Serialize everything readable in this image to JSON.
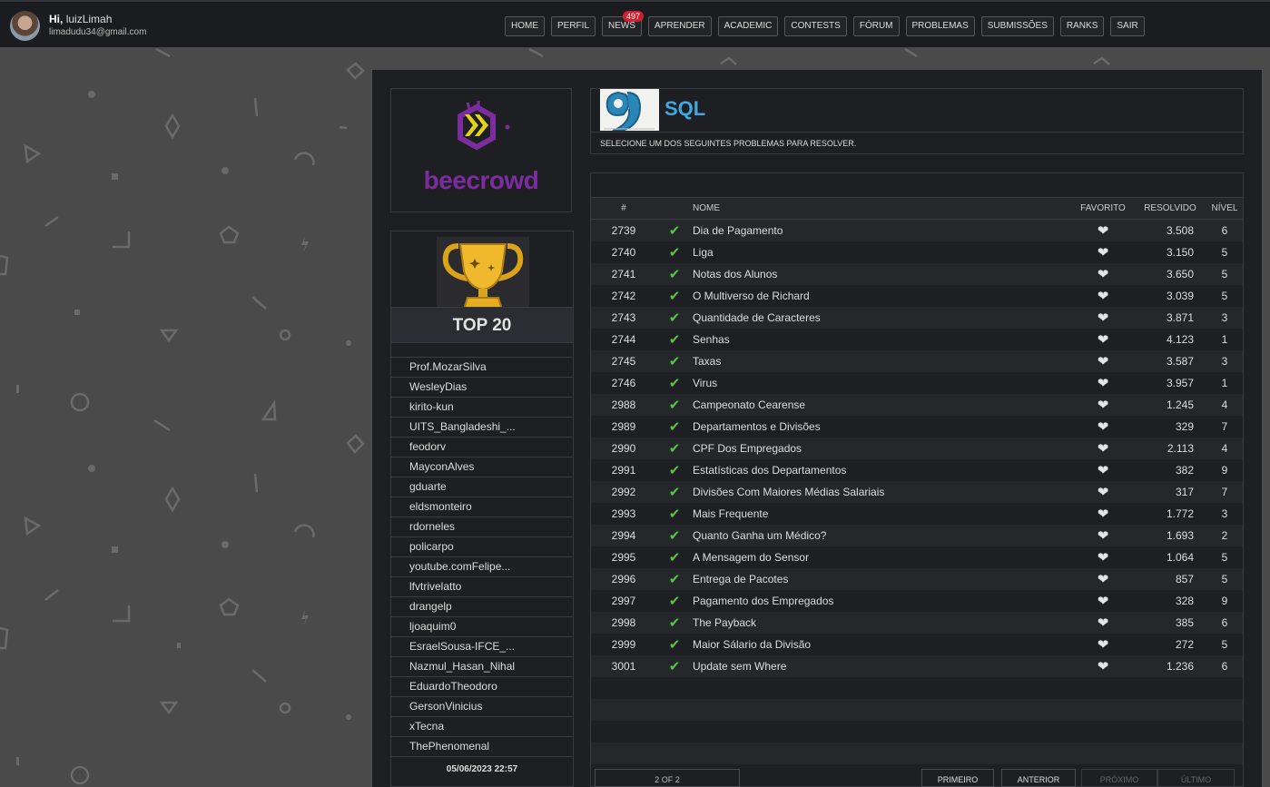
{
  "user": {
    "greeting": "Hi,",
    "name": "luizLimah",
    "email": "limadudu34@gmail.com"
  },
  "nav": [
    {
      "label": "HOME"
    },
    {
      "label": "PERFIL"
    },
    {
      "label": "NEWS",
      "badge": "497"
    },
    {
      "label": "APRENDER"
    },
    {
      "label": "ACADEMIC"
    },
    {
      "label": "CONTESTS"
    },
    {
      "label": "FÓRUM"
    },
    {
      "label": "PROBLEMAS"
    },
    {
      "label": "SUBMISSÕES"
    },
    {
      "label": "RANKS"
    },
    {
      "label": "SAIR"
    }
  ],
  "logo": {
    "text": "beecrowd",
    "color": "#7b2c9e",
    "accent": "#e7d21a"
  },
  "top20": {
    "title": "TOP 20",
    "users": [
      "Prof.MozarSilva",
      "WesleyDias",
      "kirito-kun",
      "UITS_Bangladeshi_...",
      "feodorv",
      "MayconAlves",
      "gduarte",
      "eldsmonteiro",
      "rdorneles",
      "policarpo",
      "youtube.comFelipe...",
      "lfvtrivelatto",
      "drangelp",
      "ljoaquim0",
      "EsraelSousa-IFCE_...",
      "Nazmul_Hasan_Nihal",
      "EduardoTheodoro",
      "GersonVinicius",
      "xTecna",
      "ThePhenomenal"
    ],
    "date": "05/06/2023 22:57"
  },
  "category": {
    "title": "SQL",
    "subtitle": "SELECIONE UM DOS SEGUINTES PROBLEMAS PARA RESOLVER.",
    "title_color": "#3fa8e0"
  },
  "table": {
    "headers": {
      "id": "#",
      "name": "NOME",
      "fav": "FAVORITO",
      "solved": "RESOLVIDO",
      "level": "NÍVEL"
    },
    "rows": [
      {
        "id": "2739",
        "name": "Dia de Pagamento",
        "solved": "3.508",
        "level": "6"
      },
      {
        "id": "2740",
        "name": "Liga",
        "solved": "3.150",
        "level": "5"
      },
      {
        "id": "2741",
        "name": "Notas dos Alunos",
        "solved": "3.650",
        "level": "5"
      },
      {
        "id": "2742",
        "name": "O Multiverso de Richard",
        "solved": "3.039",
        "level": "5"
      },
      {
        "id": "2743",
        "name": "Quantidade de Caracteres",
        "solved": "3.871",
        "level": "3"
      },
      {
        "id": "2744",
        "name": "Senhas",
        "solved": "4.123",
        "level": "1"
      },
      {
        "id": "2745",
        "name": "Taxas",
        "solved": "3.587",
        "level": "3"
      },
      {
        "id": "2746",
        "name": "Virus",
        "solved": "3.957",
        "level": "1"
      },
      {
        "id": "2988",
        "name": "Campeonato Cearense",
        "solved": "1.245",
        "level": "4"
      },
      {
        "id": "2989",
        "name": "Departamentos e Divisões",
        "solved": "329",
        "level": "7"
      },
      {
        "id": "2990",
        "name": "CPF Dos Empregados",
        "solved": "2.113",
        "level": "4"
      },
      {
        "id": "2991",
        "name": "Estatísticas dos Departamentos",
        "solved": "382",
        "level": "9"
      },
      {
        "id": "2992",
        "name": "Divisões Com Maiores Médias Salariais",
        "solved": "317",
        "level": "7"
      },
      {
        "id": "2993",
        "name": "Mais Frequente",
        "solved": "1.772",
        "level": "3"
      },
      {
        "id": "2994",
        "name": "Quanto Ganha um Médico?",
        "solved": "1.693",
        "level": "2"
      },
      {
        "id": "2995",
        "name": "A Mensagem do Sensor",
        "solved": "1.064",
        "level": "5"
      },
      {
        "id": "2996",
        "name": "Entrega de Pacotes",
        "solved": "857",
        "level": "5"
      },
      {
        "id": "2997",
        "name": "Pagamento dos Empregados",
        "solved": "328",
        "level": "9"
      },
      {
        "id": "2998",
        "name": "The Payback",
        "solved": "385",
        "level": "6"
      },
      {
        "id": "2999",
        "name": "Maior Sálario da Divisão",
        "solved": "272",
        "level": "5"
      },
      {
        "id": "3001",
        "name": "Update sem Where",
        "solved": "1.236",
        "level": "6"
      }
    ]
  },
  "pagination": {
    "info": "2 OF 2",
    "first": "PRIMEIRO",
    "prev": "ANTERIOR",
    "next": "PRÓXIMO",
    "last": "ÚLTIMO"
  }
}
